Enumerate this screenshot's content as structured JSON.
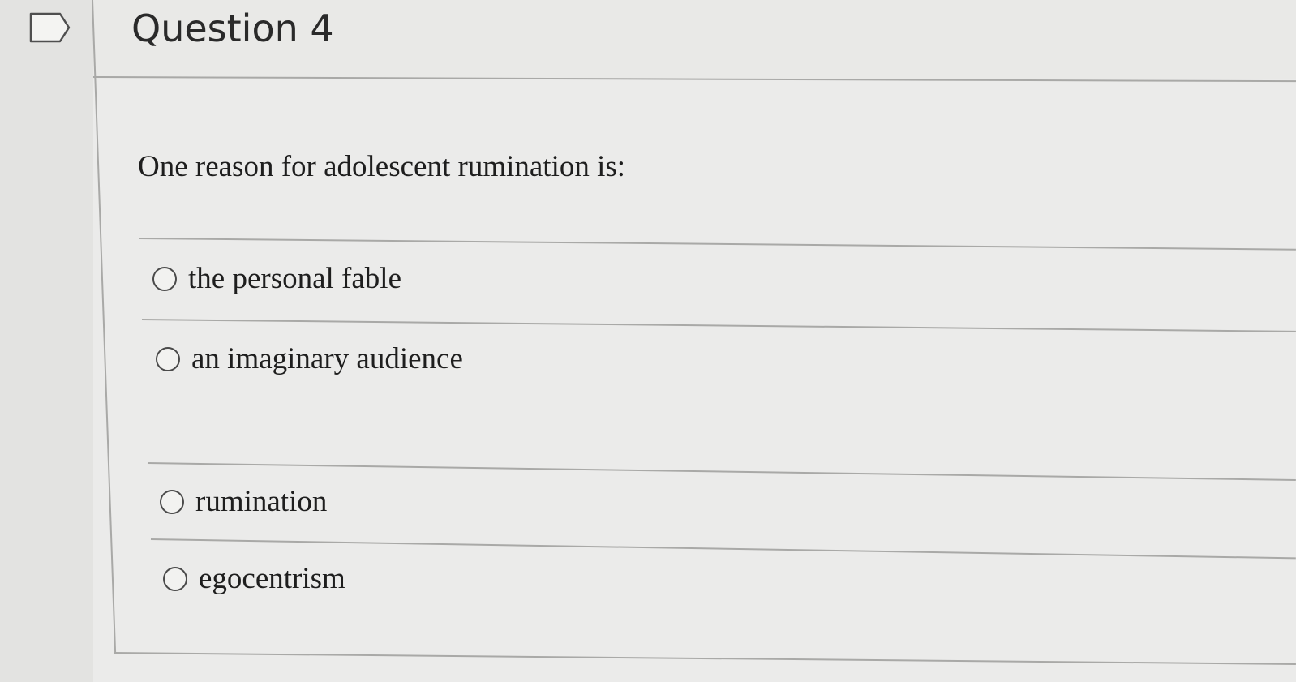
{
  "question": {
    "title": "Question 4",
    "prompt": "One reason for adolescent rumination is:",
    "options": [
      {
        "label": "the personal fable",
        "selected": false
      },
      {
        "label": "an imaginary audience",
        "selected": false
      },
      {
        "label": "rumination",
        "selected": false
      },
      {
        "label": "egocentrism",
        "selected": false
      }
    ]
  },
  "icons": {
    "flag": "flag-bookmark-icon"
  }
}
